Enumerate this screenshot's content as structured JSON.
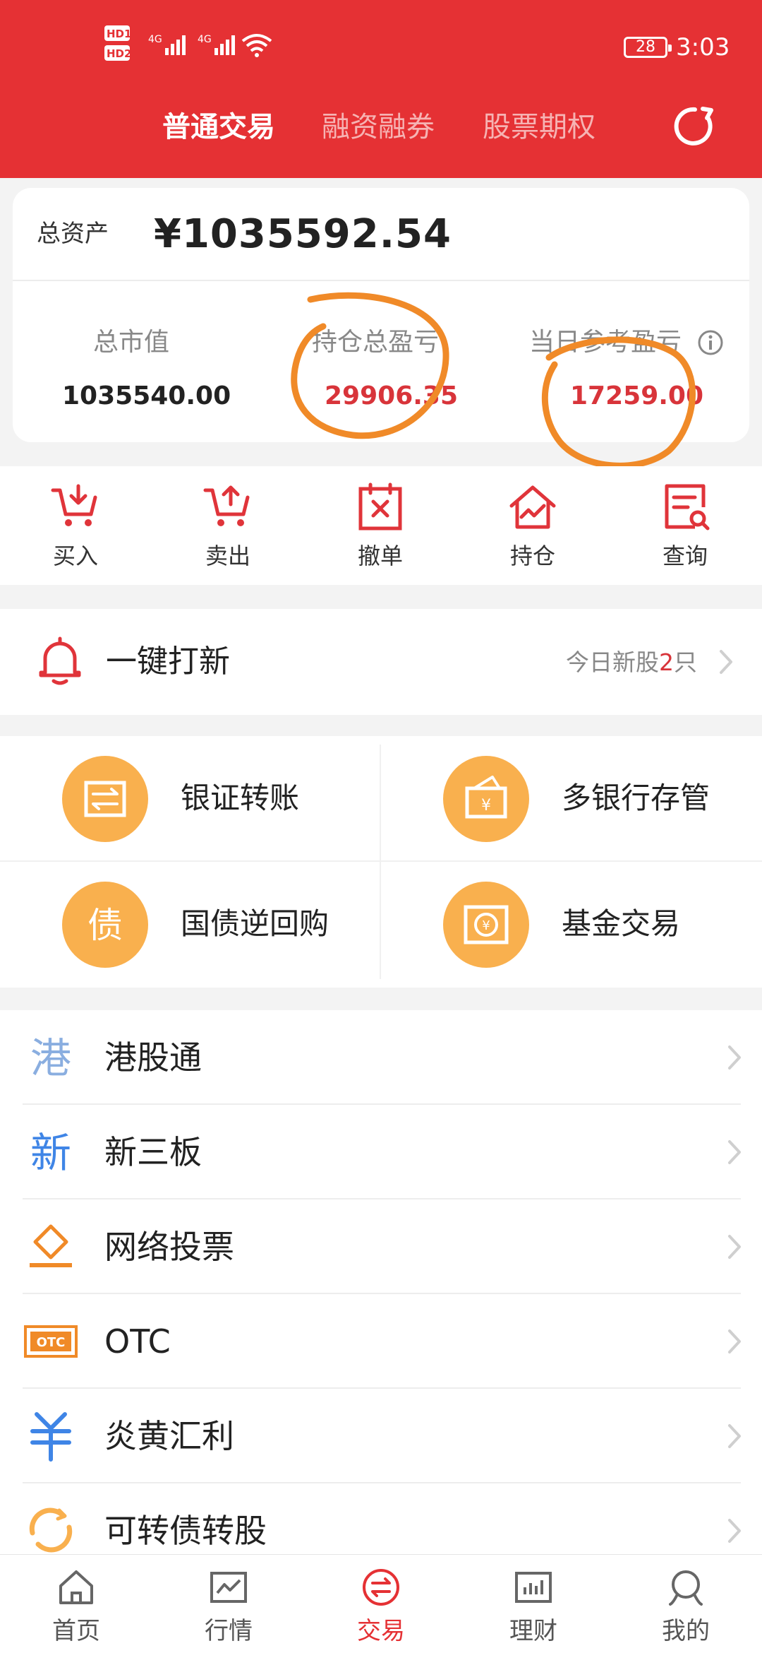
{
  "status_bar": {
    "hd1": "HD1",
    "hd2": "HD2",
    "net1": "4G",
    "net2": "4G",
    "battery": "28",
    "time": "3:03"
  },
  "header": {
    "tabs": [
      {
        "label": "普通交易",
        "active": true
      },
      {
        "label": "融资融券",
        "active": false
      },
      {
        "label": "股票期权",
        "active": false
      }
    ],
    "refresh_icon": "refresh-icon"
  },
  "assets": {
    "total_label": "总资产",
    "total_value": "¥1035592.54",
    "metrics": [
      {
        "label": "总市值",
        "value": "1035540.00"
      },
      {
        "label": "持仓总盈亏",
        "value": "29906.35"
      },
      {
        "label": "当日参考盈亏",
        "value": "17259.00"
      }
    ],
    "info_icon": "info-icon"
  },
  "actions": [
    {
      "label": "买入",
      "icon": "cart-down-icon"
    },
    {
      "label": "卖出",
      "icon": "cart-up-icon"
    },
    {
      "label": "撤单",
      "icon": "cancel-order-icon"
    },
    {
      "label": "持仓",
      "icon": "position-house-icon"
    },
    {
      "label": "查询",
      "icon": "query-doc-icon"
    }
  ],
  "ipo": {
    "title": "一键打新",
    "sub_prefix": "今日新股",
    "count": "2",
    "sub_suffix": "只"
  },
  "grid": [
    {
      "label": "银证转账",
      "icon": "transfer-icon"
    },
    {
      "label": "多银行存管",
      "icon": "bank-deposit-icon"
    },
    {
      "label": "国债逆回购",
      "icon_text": "债"
    },
    {
      "label": "基金交易",
      "icon": "fund-icon"
    }
  ],
  "list": [
    {
      "label": "港股通",
      "icon_text": "港"
    },
    {
      "label": "新三板",
      "icon_text": "新"
    },
    {
      "label": "网络投票",
      "icon": "vote-icon"
    },
    {
      "label": "OTC",
      "icon_text": "OTC"
    },
    {
      "label": "炎黄汇利",
      "icon": "yen-icon"
    },
    {
      "label": "可转债转股",
      "icon": "convert-icon"
    }
  ],
  "bottom_nav": [
    {
      "label": "首页",
      "icon": "home-icon",
      "active": false
    },
    {
      "label": "行情",
      "icon": "chart-icon",
      "active": false
    },
    {
      "label": "交易",
      "icon": "trade-icon",
      "active": true
    },
    {
      "label": "理财",
      "icon": "finance-icon",
      "active": false
    },
    {
      "label": "我的",
      "icon": "profile-icon",
      "active": false
    }
  ],
  "colors": {
    "header_red": "#e53134",
    "value_red": "#d8343a",
    "grid_orange": "#f9b04e",
    "annotation_orange": "#f08a28"
  }
}
